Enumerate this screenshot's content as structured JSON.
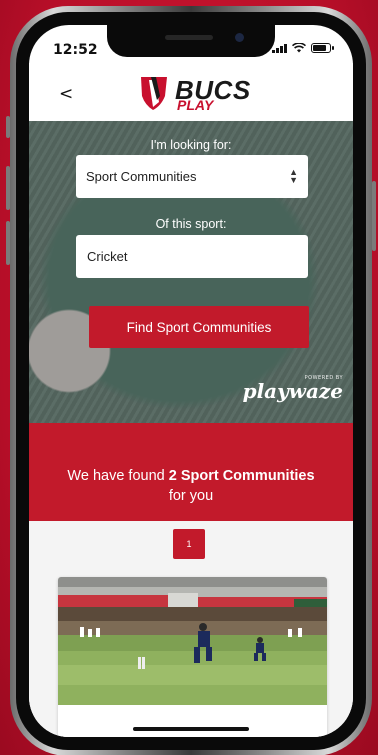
{
  "status_bar": {
    "time": "12:52"
  },
  "header": {
    "back_label": "<",
    "logo_text": "BUCS",
    "logo_sub": "PLAY"
  },
  "search": {
    "looking_for_label": "I'm looking for:",
    "looking_for_value": "Sport Communities",
    "sport_label": "Of this sport:",
    "sport_value": "Cricket",
    "submit_label": "Find Sport Communities",
    "powered_by": "POWERED BY",
    "powered_brand": "playwaze"
  },
  "results": {
    "line1_prefix": "We have found ",
    "line1_strong": "2 Sport Communities",
    "line2": "for you"
  },
  "pagination": {
    "pages": [
      "1"
    ]
  },
  "colors": {
    "brand_red": "#c21a2b",
    "page_bg": "#c8102e"
  },
  "icons": [
    "shield-logo-icon",
    "signal-icon",
    "wifi-icon",
    "battery-icon",
    "select-chevron-icon"
  ]
}
